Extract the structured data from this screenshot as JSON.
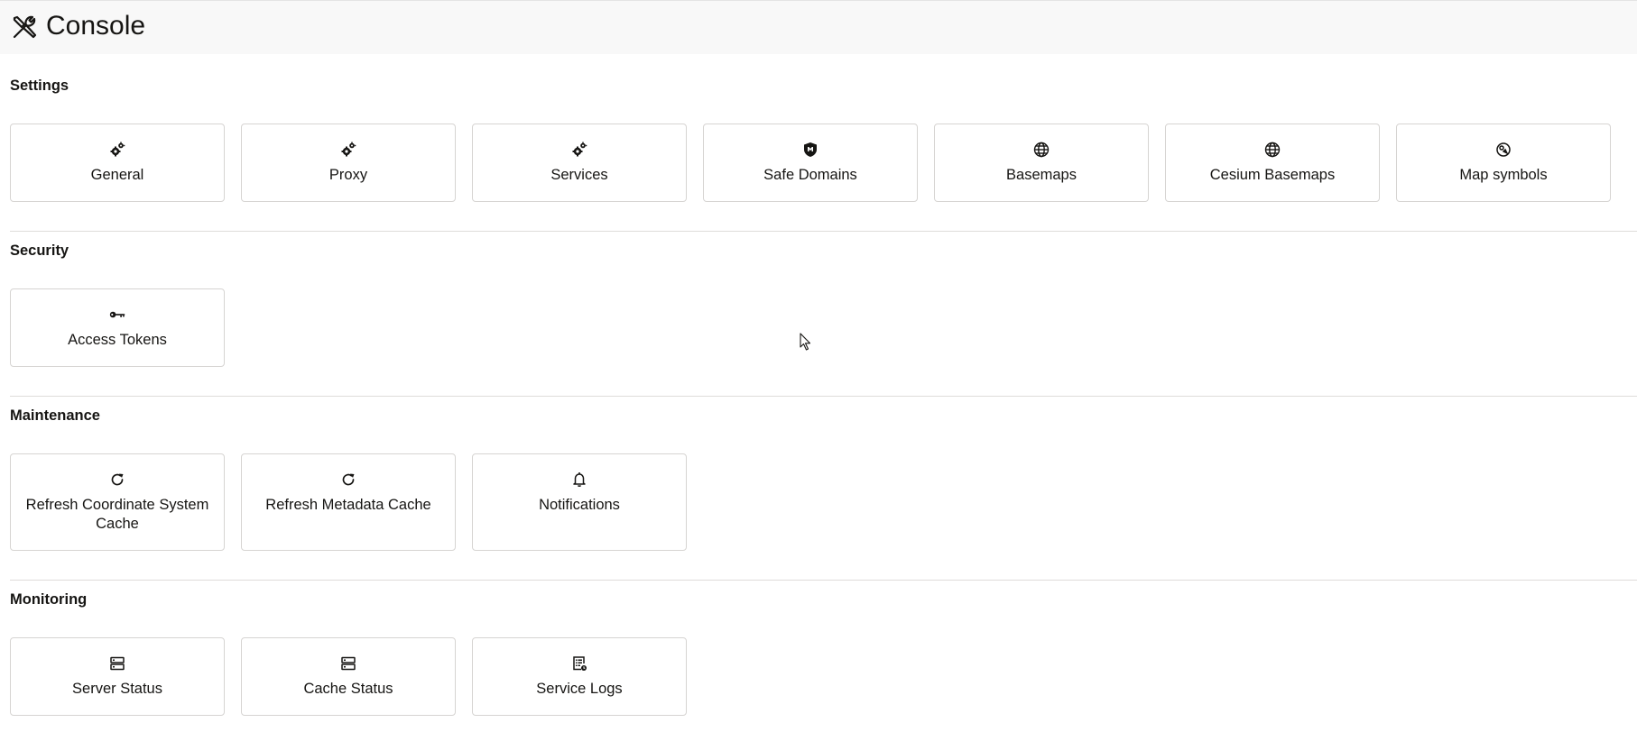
{
  "header": {
    "title": "Console",
    "icon": "tools-icon"
  },
  "sections": [
    {
      "title": "Settings",
      "tiles": [
        {
          "label": "General",
          "icon": "gears-icon"
        },
        {
          "label": "Proxy",
          "icon": "gears-icon"
        },
        {
          "label": "Services",
          "icon": "gears-icon"
        },
        {
          "label": "Safe Domains",
          "icon": "shield-icon"
        },
        {
          "label": "Basemaps",
          "icon": "globe-icon"
        },
        {
          "label": "Cesium Basemaps",
          "icon": "globe-icon"
        },
        {
          "label": "Map symbols",
          "icon": "symbol-icon"
        }
      ]
    },
    {
      "title": "Security",
      "tiles": [
        {
          "label": "Access Tokens",
          "icon": "key-icon"
        }
      ]
    },
    {
      "title": "Maintenance",
      "tiles": [
        {
          "label": "Refresh Coordinate System Cache",
          "icon": "refresh-icon"
        },
        {
          "label": "Refresh Metadata Cache",
          "icon": "refresh-icon"
        },
        {
          "label": "Notifications",
          "icon": "bell-icon"
        }
      ]
    },
    {
      "title": "Monitoring",
      "tiles": [
        {
          "label": "Server Status",
          "icon": "server-icon"
        },
        {
          "label": "Cache Status",
          "icon": "server-icon"
        },
        {
          "label": "Service Logs",
          "icon": "log-icon"
        }
      ]
    }
  ]
}
